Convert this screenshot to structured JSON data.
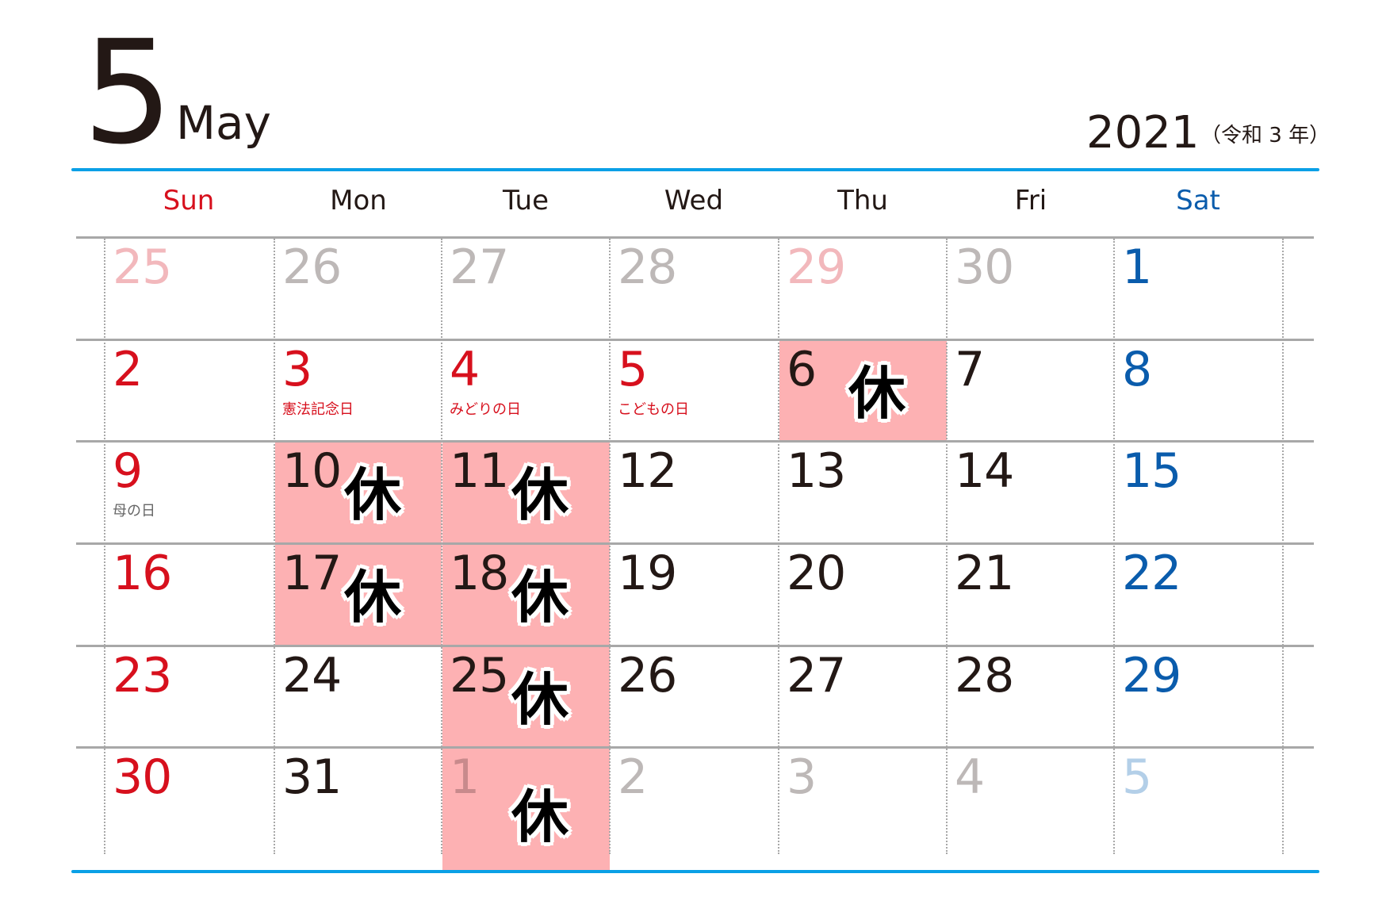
{
  "header": {
    "month_number": "5",
    "month_name": "May",
    "year": "2021",
    "era": "（令和 3 年）"
  },
  "colors": {
    "accent_line": "#0aa0e6",
    "sunday": "#d7101d",
    "saturday": "#0a5cac",
    "weekday": "#231815",
    "other_month_weekday": "#bdb8b7",
    "other_month_sunday": "#f2b8bc",
    "other_month_saturday": "#b3cfe8",
    "closed_fill": "#fdb1b3",
    "holiday_label": "#d7101d",
    "observance_label": "#666666"
  },
  "weekdays": [
    {
      "label": "Sun",
      "kind": "sun"
    },
    {
      "label": "Mon",
      "kind": "wd"
    },
    {
      "label": "Tue",
      "kind": "wd"
    },
    {
      "label": "Wed",
      "kind": "wd"
    },
    {
      "label": "Thu",
      "kind": "wd"
    },
    {
      "label": "Fri",
      "kind": "wd"
    },
    {
      "label": "Sat",
      "kind": "sat"
    }
  ],
  "closed_mark": "休",
  "weeks": [
    [
      {
        "day": "25",
        "other": true
      },
      {
        "day": "26",
        "other": true
      },
      {
        "day": "27",
        "other": true
      },
      {
        "day": "28",
        "other": true
      },
      {
        "day": "29",
        "other": true,
        "holiday": true
      },
      {
        "day": "30",
        "other": true
      },
      {
        "day": "1"
      }
    ],
    [
      {
        "day": "2"
      },
      {
        "day": "3",
        "holiday": true,
        "label": "憲法記念日"
      },
      {
        "day": "4",
        "holiday": true,
        "label": "みどりの日"
      },
      {
        "day": "5",
        "holiday": true,
        "label": "こどもの日"
      },
      {
        "day": "6",
        "closed": true
      },
      {
        "day": "7"
      },
      {
        "day": "8"
      }
    ],
    [
      {
        "day": "9",
        "label": "母の日",
        "observance": true
      },
      {
        "day": "10",
        "closed": true
      },
      {
        "day": "11",
        "closed": true
      },
      {
        "day": "12"
      },
      {
        "day": "13"
      },
      {
        "day": "14"
      },
      {
        "day": "15"
      }
    ],
    [
      {
        "day": "16"
      },
      {
        "day": "17",
        "closed": true
      },
      {
        "day": "18",
        "closed": true
      },
      {
        "day": "19"
      },
      {
        "day": "20"
      },
      {
        "day": "21"
      },
      {
        "day": "22"
      }
    ],
    [
      {
        "day": "23"
      },
      {
        "day": "24"
      },
      {
        "day": "25",
        "closed": true
      },
      {
        "day": "26"
      },
      {
        "day": "27"
      },
      {
        "day": "28"
      },
      {
        "day": "29"
      }
    ],
    [
      {
        "day": "30"
      },
      {
        "day": "31"
      },
      {
        "day": "1",
        "other": true,
        "closed": true
      },
      {
        "day": "2",
        "other": true
      },
      {
        "day": "3",
        "other": true
      },
      {
        "day": "4",
        "other": true
      },
      {
        "day": "5",
        "other": true
      }
    ]
  ]
}
